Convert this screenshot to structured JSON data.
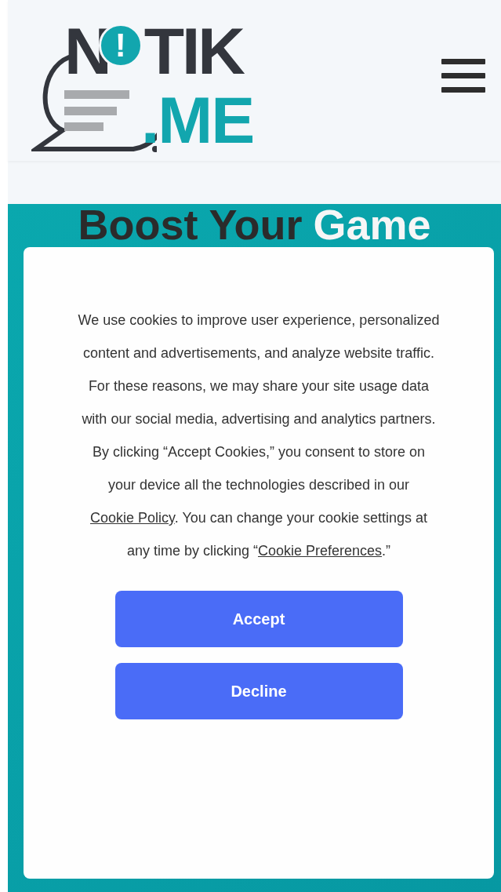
{
  "header": {
    "logo": {
      "first_letter": "N",
      "mark": "!",
      "rest": "TIK",
      "suffix": ".ME"
    }
  },
  "hero": {
    "headline": [
      {
        "kind": "plain",
        "text": "Boost Your"
      },
      {
        "kind": "accent",
        "text": "Game"
      }
    ]
  },
  "cookie_dialog": {
    "message": [
      {
        "kind": "text",
        "text": "We use cookies to improve user experience, personalized content and advertisements, and analyze website traffic. For these reasons, we may share your site usage data with our social media, advertising and analytics partners. By clicking “Accept Cookies,” you consent to store on your device all the technologies described in our "
      },
      {
        "kind": "link",
        "text": "Cookie Policy"
      },
      {
        "kind": "text",
        "text": ". You can change your cookie settings at any time by clicking “"
      },
      {
        "kind": "link",
        "text": "Cookie Preferences"
      },
      {
        "kind": "text",
        "text": ".”"
      }
    ],
    "buttons": [
      "Accept",
      "Decline"
    ]
  }
}
